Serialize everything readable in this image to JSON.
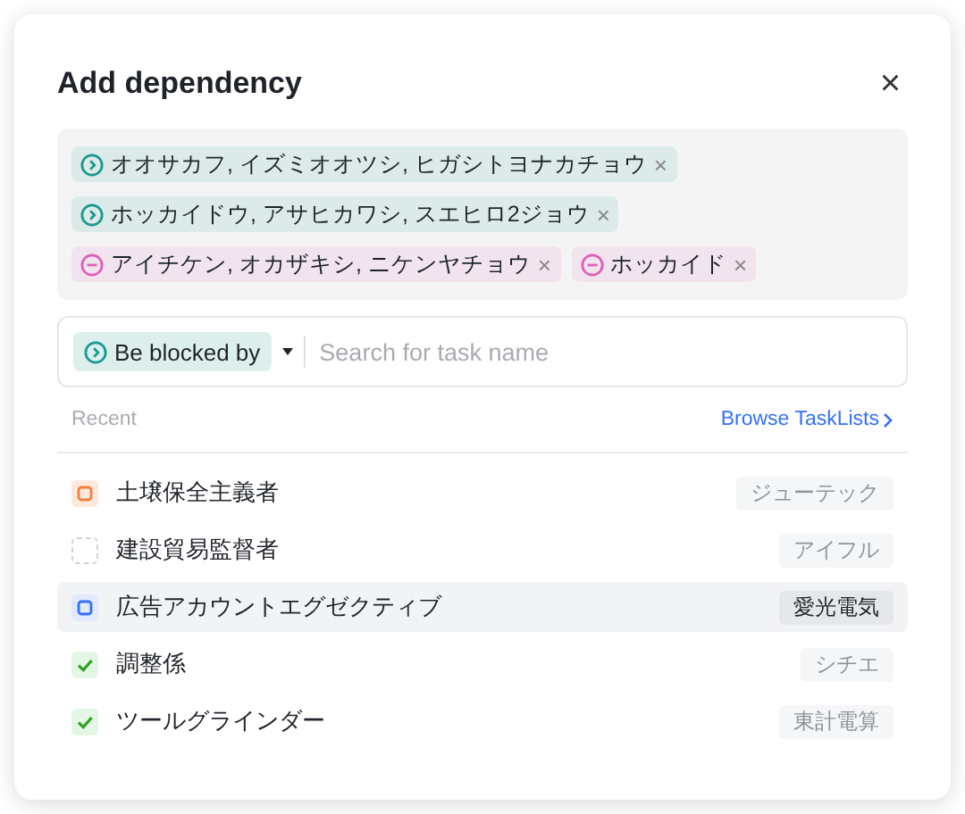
{
  "dialog": {
    "title": "Add dependency",
    "close": "×"
  },
  "tags": [
    {
      "kind": "blocked-by",
      "label": "オオサカフ, イズミオオツシ, ヒガシトヨナカチョウ",
      "remove": "×"
    },
    {
      "kind": "blocked-by",
      "label": "ホッカイドウ, アサヒカワシ, スエヒロ2ジョウ",
      "remove": "×"
    },
    {
      "kind": "blocking",
      "label": "アイチケン, オカザキシ, ニケンヤチョウ",
      "remove": "×"
    },
    {
      "kind": "blocking",
      "label": "ホッカイド",
      "remove": "×"
    }
  ],
  "search": {
    "relation": {
      "kind": "blocked-by",
      "label": "Be blocked by"
    },
    "placeholder": "Search for task name"
  },
  "recent": {
    "label": "Recent",
    "link": "Browse TaskLists"
  },
  "tasks": [
    {
      "kind": "orange",
      "name": "土壌保全主義者",
      "list": "ジューテック",
      "highlighted": false
    },
    {
      "kind": "none",
      "name": "建設貿易監督者",
      "list": "アイフル",
      "highlighted": false
    },
    {
      "kind": "blue",
      "name": "広告アカウントエグゼクティブ",
      "list": "愛光電気",
      "highlighted": true
    },
    {
      "kind": "done",
      "name": "調整係",
      "list": "シチエ",
      "highlighted": false
    },
    {
      "kind": "done",
      "name": "ツールグラインダー",
      "list": "東計電算",
      "highlighted": false
    }
  ]
}
